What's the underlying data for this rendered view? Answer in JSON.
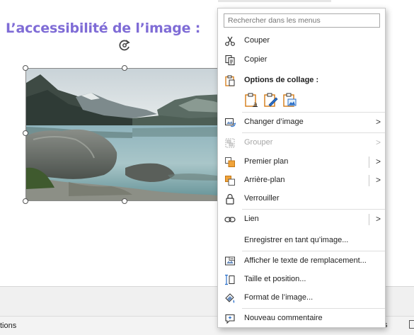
{
  "slide": {
    "title": "L’accessibilité de l’image :"
  },
  "status_bar": {
    "left_text": "tions",
    "right_text": "s"
  },
  "context_menu": {
    "search_placeholder": "Rechercher dans les menus",
    "items": [
      {
        "label": "Couper",
        "icon": "scissors-icon"
      },
      {
        "label": "Copier",
        "icon": "copy-icon"
      },
      {
        "label": "Options de collage :",
        "icon": "clipboard-icon"
      },
      {
        "label": "Changer d’image",
        "icon": "change-picture-icon",
        "submenu": true
      },
      {
        "label": "Grouper",
        "icon": "group-icon",
        "submenu": true,
        "disabled": true
      },
      {
        "label": "Premier plan",
        "icon": "bring-forward-icon",
        "submenu": true
      },
      {
        "label": "Arrière-plan",
        "icon": "send-backward-icon",
        "submenu": true
      },
      {
        "label": "Verrouiller",
        "icon": "lock-icon"
      },
      {
        "label": "Lien",
        "icon": "link-icon",
        "submenu": true
      },
      {
        "label": "Enregistrer en tant qu’image...",
        "icon": ""
      },
      {
        "label": "Afficher le texte de remplacement...",
        "icon": "alt-text-icon"
      },
      {
        "label": "Taille et position...",
        "icon": "size-position-icon"
      },
      {
        "label": "Format de l’image...",
        "icon": "format-picture-icon"
      },
      {
        "label": "Nouveau commentaire",
        "icon": "comment-icon"
      }
    ],
    "paste_options": [
      "paste-keep-text-icon",
      "paste-edit-icon",
      "paste-picture-icon"
    ],
    "arrow_glyph": ">"
  },
  "colors": {
    "title": "#7f6cd6",
    "menu_icon_orange": "#d47a14",
    "menu_icon_blue": "#2a6fc9"
  }
}
